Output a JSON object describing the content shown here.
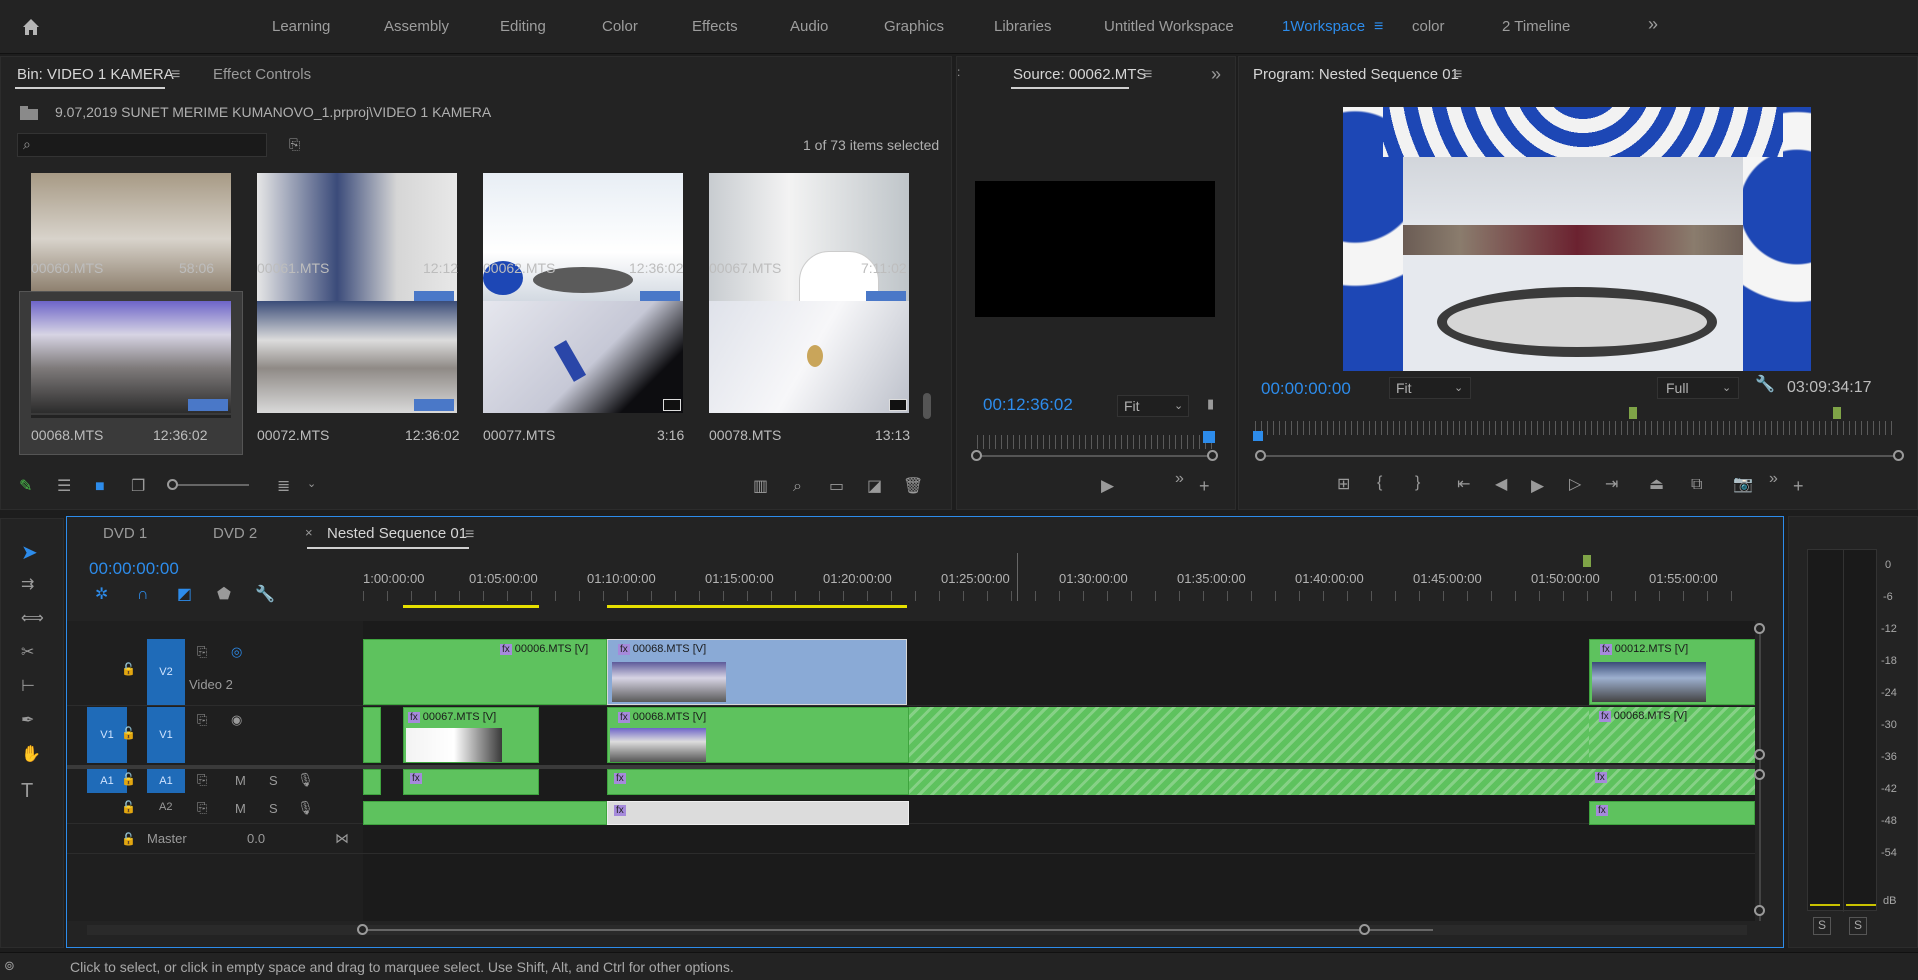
{
  "workspaces": {
    "items": [
      "Learning",
      "Assembly",
      "Editing",
      "Color",
      "Effects",
      "Audio",
      "Graphics",
      "Libraries",
      "Untitled Workspace",
      "1Workspace",
      "color",
      "2 Timeline"
    ],
    "active": "1Workspace",
    "more": "»"
  },
  "project": {
    "tab_bin": "Bin: VIDEO  1 KAMERA",
    "tab_effects": "Effect Controls",
    "path": "9.07,2019  SUNET MERIME KUMANOVO_1.prproj\\VIDEO  1 KAMERA",
    "selection_info": "1 of 73 items selected",
    "search_placeholder": "",
    "items": [
      {
        "name": "00060.MTS",
        "duration": "58:06"
      },
      {
        "name": "00061.MTS",
        "duration": "12:12"
      },
      {
        "name": "00062.MTS",
        "duration": "12:36:02"
      },
      {
        "name": "00067.MTS",
        "duration": "7:11:02"
      },
      {
        "name": "00068.MTS",
        "duration": "12:36:02"
      },
      {
        "name": "00072.MTS",
        "duration": "12:36:02"
      },
      {
        "name": "00077.MTS",
        "duration": "3:16"
      },
      {
        "name": "00078.MTS",
        "duration": "13:13"
      }
    ]
  },
  "source": {
    "title": "Source: 00062.MTS",
    "timecode": "00:12:36:02",
    "fit": "Fit"
  },
  "program": {
    "title": "Program: Nested Sequence 01",
    "timecode": "00:00:00:00",
    "fit": "Fit",
    "quality": "Full",
    "duration": "03:09:34:17"
  },
  "timeline": {
    "tabs": [
      "DVD 1",
      "DVD 2",
      "Nested Sequence 01"
    ],
    "active_tab": "Nested Sequence 01",
    "close": "×",
    "timecode": "00:00:00:00",
    "ruler": [
      "1:00:00:00",
      "01:05:00:00",
      "01:10:00:00",
      "01:15:00:00",
      "01:20:00:00",
      "01:25:00:00",
      "01:30:00:00",
      "01:35:00:00",
      "01:40:00:00",
      "01:45:00:00",
      "01:50:00:00",
      "01:55:00:00"
    ],
    "tracks": {
      "v2_name": "Video 2",
      "v2": "V2",
      "v1_src": "V1",
      "v1": "V1",
      "a1_src": "A1",
      "a1": "A1",
      "a2": "A2",
      "master": "Master",
      "master_value": "0.0",
      "m": "M",
      "s": "S"
    },
    "clips": {
      "c1": "00006.MTS [V]",
      "c2": "00068.MTS [V]",
      "c3": "00012.MTS [V]",
      "c4": "00067.MTS [V]",
      "c5": "00068.MTS [V]",
      "c6": "00068.MTS [V]",
      "fx": "fx"
    }
  },
  "meter": {
    "scale": [
      "0",
      "-6",
      "-12",
      "-18",
      "-24",
      "-30",
      "-36",
      "-42",
      "-48",
      "-54",
      "dB"
    ],
    "solo": "S"
  },
  "status": {
    "text": "Click to select, or click in empty space and drag to marquee select. Use Shift, Alt, and Ctrl for other options."
  },
  "colors": {
    "accent": "#2d8ceb",
    "clip": "#5ec25e",
    "selected_clip": "#8aaad6",
    "track_target": "#1f6bb8"
  }
}
